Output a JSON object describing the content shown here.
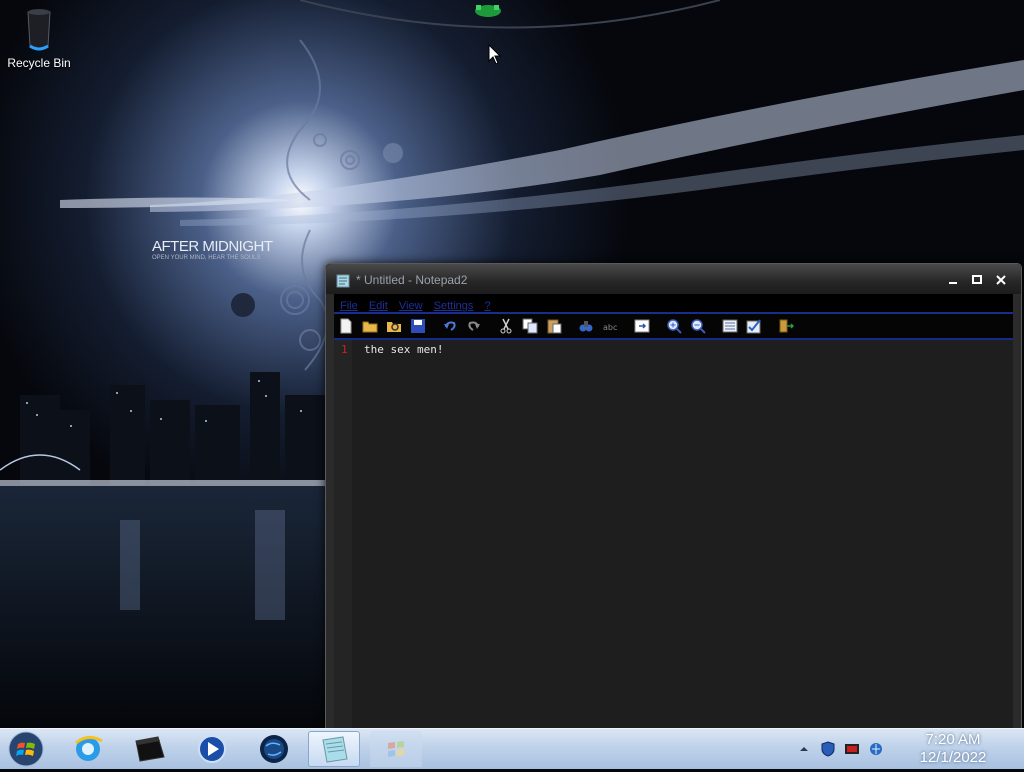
{
  "desktop": {
    "icons": [
      {
        "label": "Recycle Bin",
        "icon": "recycle-bin-icon"
      }
    ],
    "wallpaper": {
      "title": "AFTER MIDNIGHT",
      "subtitle": "OPEN YOUR MIND, HEAR THE SOULS"
    }
  },
  "notepad": {
    "title": "* Untitled - Notepad2",
    "menu": [
      "File",
      "Edit",
      "View",
      "Settings",
      "?"
    ],
    "toolbar": [
      "new-file-icon",
      "open-folder-icon",
      "browse-icon",
      "save-icon",
      "undo-icon",
      "redo-icon",
      "cut-icon",
      "copy-icon",
      "paste-icon",
      "find-icon",
      "replace-icon",
      "goto-icon",
      "zoom-in-icon",
      "zoom-out-icon",
      "scheme-icon",
      "customize-icon",
      "exit-icon"
    ],
    "lines": [
      {
        "number": "1",
        "text": "the sex men!"
      }
    ]
  },
  "taskbar": {
    "pinned": [
      "internet-explorer-icon",
      "folder-icon",
      "media-player-icon",
      "browser-globe-icon",
      "notepad2-icon",
      "windows-flag-icon"
    ],
    "tray": [
      "show-hidden-icons",
      "shield-icon",
      "monitor-icon",
      "network-icon"
    ],
    "time": "7:20 AM",
    "date": "12/1/2022"
  },
  "colors": {
    "accent": "#1a2d8a",
    "line_number": "#d02020",
    "taskbar": "#bfd2ea"
  }
}
